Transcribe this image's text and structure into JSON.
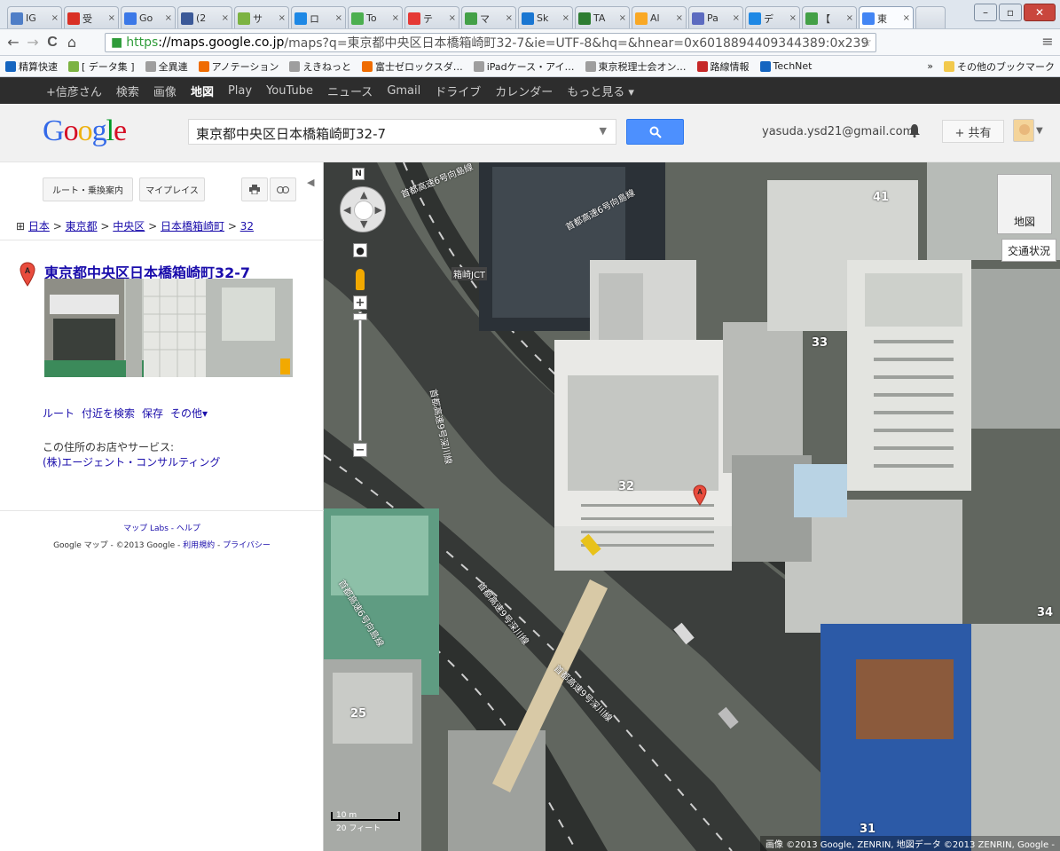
{
  "browser": {
    "tabs": [
      {
        "label": "IG",
        "color": "#4f7ec7"
      },
      {
        "label": "受",
        "color": "#d93025"
      },
      {
        "label": "Go",
        "color": "#3b78e7"
      },
      {
        "label": "(2",
        "color": "#3b5998"
      },
      {
        "label": "サ",
        "color": "#7cb342"
      },
      {
        "label": "ロ",
        "color": "#1e88e5"
      },
      {
        "label": "To",
        "color": "#4caf50"
      },
      {
        "label": "テ",
        "color": "#e53935"
      },
      {
        "label": "マ",
        "color": "#43a047"
      },
      {
        "label": "Sk",
        "color": "#1976d2"
      },
      {
        "label": "TA",
        "color": "#2e7d32"
      },
      {
        "label": "Al",
        "color": "#f9a825"
      },
      {
        "label": "Pa",
        "color": "#5c6bc0"
      },
      {
        "label": "デ",
        "color": "#1e88e5"
      },
      {
        "label": "【",
        "color": "#43a047"
      },
      {
        "label": "東",
        "color": "#4285f4",
        "active": true
      }
    ],
    "tab_close": "×",
    "url_https": "https",
    "url_host": "://maps.google.co.jp",
    "url_rest": "/maps?q=東京都中央区日本橋箱崎町32-7&ie=UTF-8&hq=&hnear=0x6018894409344389:0x239",
    "back": "←",
    "forward": "→",
    "reload": "C",
    "home": "⌂",
    "star": "☆",
    "menu": "≡",
    "lock": "🔒",
    "bookmarks": [
      {
        "label": "精算快速",
        "color": "#1565c0"
      },
      {
        "label": "[ データ集 ]",
        "color": "#7cb342"
      },
      {
        "label": "全異連",
        "color": "#9e9e9e"
      },
      {
        "label": "アノテーション",
        "color": "#ef6c00"
      },
      {
        "label": "えきねっと",
        "color": "#9e9e9e"
      },
      {
        "label": "富士ゼロックスダ…",
        "color": "#ef6c00"
      },
      {
        "label": "iPadケース・アイ…",
        "color": "#9e9e9e"
      },
      {
        "label": "東京税理士会オン…",
        "color": "#9e9e9e"
      },
      {
        "label": "路線情報",
        "color": "#c62828"
      },
      {
        "label": "TechNet",
        "color": "#1565c0"
      }
    ],
    "bookmarks_more": "»",
    "bookmarks_other": "その他のブックマーク"
  },
  "gbar": {
    "items": [
      "+信彦さん",
      "検索",
      "画像",
      "地図",
      "Play",
      "YouTube",
      "ニュース",
      "Gmail",
      "ドライブ",
      "カレンダー",
      "もっと見る ▾"
    ],
    "active_index": 3
  },
  "header": {
    "logo": "Google",
    "search_value": "東京都中央区日本橋箱崎町32-7",
    "search_button": "🔍",
    "account": "yasuda.ysd21@gmail.com",
    "bell": "🔔",
    "share": "+ 共有"
  },
  "panel": {
    "route_button": "ルート・乗換案内",
    "myplaces_button": "マイプレイス",
    "print_icon": "🖶",
    "link_icon": "⊙",
    "collapse": "◀",
    "crumbs": [
      "日本",
      "東京都",
      "中央区",
      "日本橋箱崎町",
      "32"
    ],
    "crumb_sep": " > ",
    "crumb_prefix": "⊞ ",
    "place_title": "東京都中央区日本橋箱崎町32-7",
    "actions": [
      "ルート",
      "付近を検索",
      "保存",
      "その他▾"
    ],
    "services_label": "この住所のお店やサービス:",
    "services_link": "(株)エージェント・コンサルティング",
    "footer_links": "マップ Labs - ヘルプ",
    "footer_text": "Google マップ - ©2013 Google - ",
    "footer_terms": "利用規約",
    "footer_sep": " - ",
    "footer_privacy": "プライバシー"
  },
  "map": {
    "compass": "N",
    "zoom_in": "+",
    "zoom_out": "−",
    "maptype": "地図",
    "traffic": "交通状況",
    "scale_top": "10 m",
    "scale_bottom": "20 フィート",
    "copyright": "画像 ©2013 Google, ZENRIN, 地図データ ©2013 ZENRIN, Google -",
    "marker_label": "A",
    "block_numbers": [
      "41",
      "33",
      "32",
      "34",
      "25",
      "31"
    ],
    "road_labels": [
      "首都高速6号向島線",
      "首都高速6号向島線",
      "首都高速9号深川線",
      "首都高速9号深川線",
      "首都高速6号向島線",
      "首都高速9号深川線",
      "箱崎JCT"
    ]
  }
}
